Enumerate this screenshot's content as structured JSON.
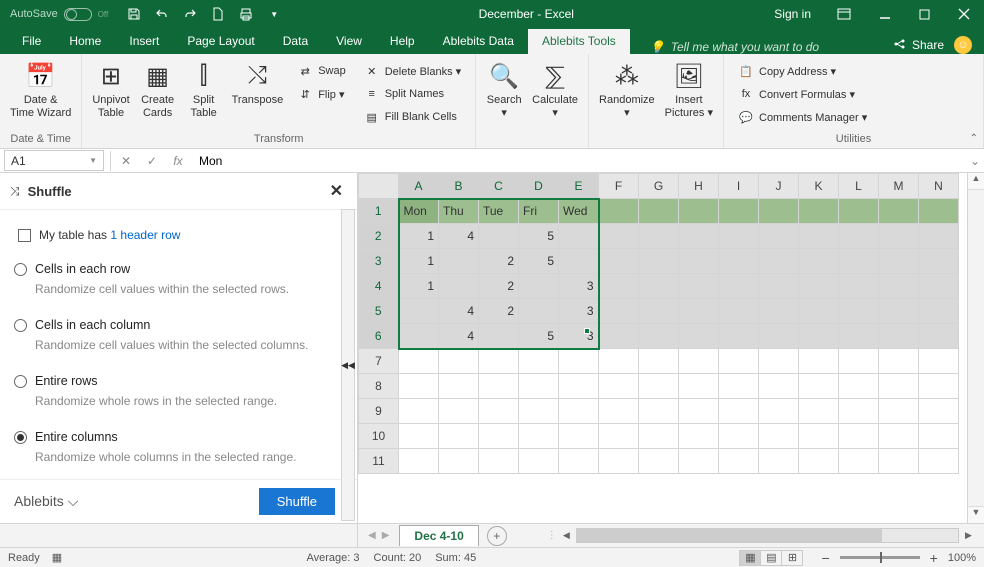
{
  "titlebar": {
    "autosave_label": "AutoSave",
    "autosave_state": "Off",
    "title": "December - Excel",
    "signin": "Sign in"
  },
  "tabs": {
    "items": [
      "File",
      "Home",
      "Insert",
      "Page Layout",
      "Data",
      "View",
      "Help",
      "Ablebits Data",
      "Ablebits Tools"
    ],
    "active": "Ablebits Tools",
    "tellme_icon": "lightbulb",
    "tellme": "Tell me what you want to do",
    "share": "Share"
  },
  "ribbon": {
    "groups": [
      {
        "title": "Date & Time",
        "buttons": [
          {
            "label": "Date &\nTime Wizard",
            "icon": "📅"
          }
        ]
      },
      {
        "title": "Transform",
        "buttons": [
          {
            "label": "Unpivot\nTable",
            "icon": "⊞"
          },
          {
            "label": "Create\nCards",
            "icon": "▦"
          },
          {
            "label": "Split\nTable",
            "icon": "⫿"
          },
          {
            "label": "Transpose",
            "icon": "⤭"
          }
        ],
        "small": [
          {
            "label": "Swap",
            "icon": "⇄"
          },
          {
            "label": "Flip ▾",
            "icon": "⇵"
          }
        ],
        "small2": [
          {
            "label": "Delete Blanks ▾",
            "icon": "✕"
          },
          {
            "label": "Split Names",
            "icon": "≡"
          },
          {
            "label": "Fill Blank Cells",
            "icon": "▤"
          }
        ]
      },
      {
        "title": "",
        "buttons": [
          {
            "label": "Search\n▾",
            "icon": "🔍"
          },
          {
            "label": "Calculate\n▾",
            "icon": "⅀"
          }
        ]
      },
      {
        "title": "",
        "buttons": [
          {
            "label": "Randomize\n▾",
            "icon": "⁂"
          },
          {
            "label": "Insert\nPictures ▾",
            "icon": "🖼"
          }
        ]
      },
      {
        "title": "Utilities",
        "small": [
          {
            "label": "Copy Address  ▾",
            "icon": "📋"
          },
          {
            "label": "Convert Formulas ▾",
            "icon": "fx"
          },
          {
            "label": "Comments Manager  ▾",
            "icon": "💬"
          }
        ]
      }
    ]
  },
  "fbar": {
    "namebox": "A1",
    "fx": "fx",
    "value": "Mon"
  },
  "pane": {
    "title": "Shuffle",
    "checkbox_prefix": "My table has",
    "checkbox_link": "1 header row",
    "options": [
      {
        "title": "Cells in each row",
        "desc": "Randomize cell values within the selected rows.",
        "selected": false
      },
      {
        "title": "Cells in each column",
        "desc": "Randomize cell values within the selected columns.",
        "selected": false
      },
      {
        "title": "Entire rows",
        "desc": "Randomize whole rows in the selected range.",
        "selected": false
      },
      {
        "title": "Entire columns",
        "desc": "Randomize whole columns in the selected range.",
        "selected": true
      }
    ],
    "brand": "Ablebits ⌵",
    "action": "Shuffle"
  },
  "grid": {
    "columns": [
      "A",
      "B",
      "C",
      "D",
      "E",
      "F",
      "G",
      "H",
      "I",
      "J",
      "K",
      "L",
      "M",
      "N"
    ],
    "sel_cols": [
      "A",
      "B",
      "C",
      "D",
      "E"
    ],
    "sel_rows": [
      1,
      2,
      3,
      4,
      5,
      6
    ],
    "headers": [
      "Mon",
      "Thu",
      "Tue",
      "Fri",
      "Wed"
    ],
    "data": [
      [
        "1",
        "4",
        "",
        "5",
        ""
      ],
      [
        "1",
        "",
        "2",
        "5",
        ""
      ],
      [
        "1",
        "",
        "2",
        "",
        "3"
      ],
      [
        "",
        "4",
        "2",
        "",
        "3"
      ],
      [
        "",
        "4",
        "",
        "5",
        "3"
      ]
    ],
    "empty_rows": [
      7,
      8,
      9,
      10,
      11
    ]
  },
  "sheettabs": {
    "active": "Dec 4-10"
  },
  "status": {
    "ready": "Ready",
    "average": "Average: 3",
    "count": "Count: 20",
    "sum": "Sum: 45",
    "zoom": "100%"
  }
}
